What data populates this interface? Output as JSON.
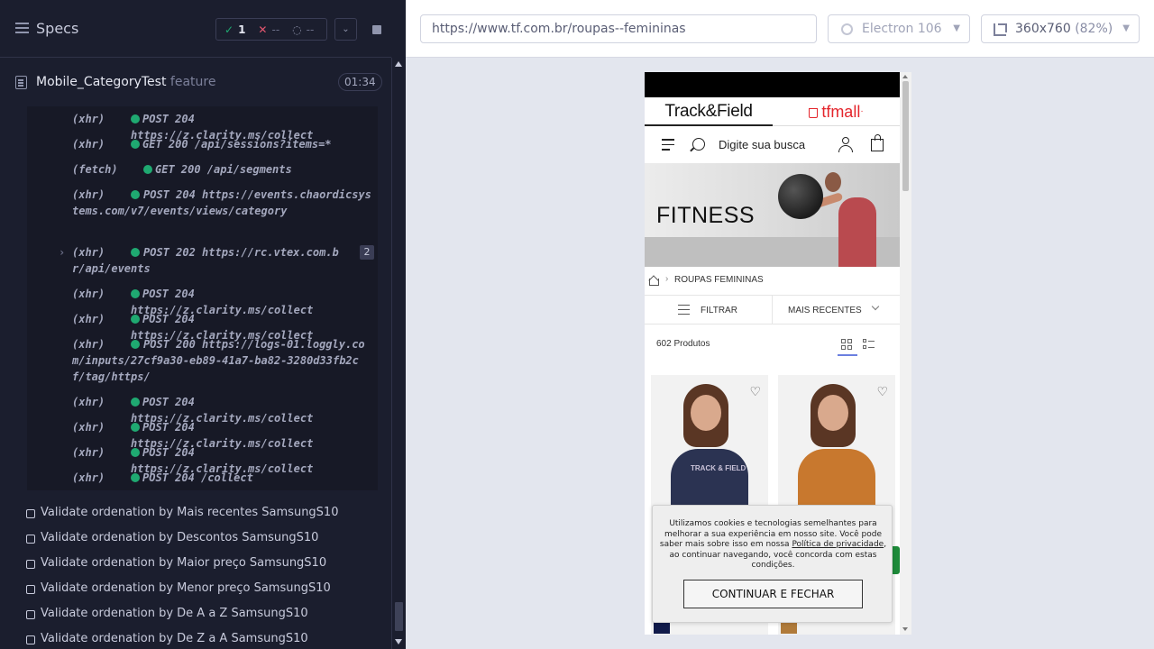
{
  "reporter": {
    "title": "Specs",
    "stats": {
      "passed": "1",
      "failed": "--",
      "pending": "--"
    },
    "spec": {
      "name": "Mobile_CategoryTest",
      "ext": "feature",
      "duration": "01:34"
    },
    "logs": [
      {
        "type": "(xhr)",
        "msg": "POST 204 https://z.clarity.ms/collect"
      },
      {
        "type": "(xhr)",
        "msg": "GET 200 /api/sessions?items=*"
      },
      {
        "type": "(fetch)",
        "msg": "GET 200 /api/segments"
      },
      {
        "type": "(xhr)",
        "msg": "POST 204 https://events.chaordicsystems.com/v7/events/views/category"
      },
      {
        "type": "(xhr)",
        "msg": "POST 202 https://rc.vtex.com.br/api/events",
        "count": "2"
      },
      {
        "type": "(xhr)",
        "msg": "POST 204 https://z.clarity.ms/collect"
      },
      {
        "type": "(xhr)",
        "msg": "POST 204 https://z.clarity.ms/collect"
      },
      {
        "type": "(xhr)",
        "msg": "POST 200 https://logs-01.loggly.com/inputs/27cf9a30-eb89-41a7-ba82-3280d33fb2cf/tag/https/"
      },
      {
        "type": "(xhr)",
        "msg": "POST 204 https://z.clarity.ms/collect"
      },
      {
        "type": "(xhr)",
        "msg": "POST 204 https://z.clarity.ms/collect"
      },
      {
        "type": "(xhr)",
        "msg": "POST 204 https://z.clarity.ms/collect"
      },
      {
        "type": "(xhr)",
        "msg": "POST 204 /collect"
      }
    ],
    "tests": [
      "Validate ordenation by Mais recentes SamsungS10",
      "Validate ordenation by Descontos SamsungS10",
      "Validate ordenation by Maior preço SamsungS10",
      "Validate ordenation by Menor preço SamsungS10",
      "Validate ordenation by De A a Z SamsungS10",
      "Validate ordenation by De Z a A SamsungS10"
    ]
  },
  "browser_bar": {
    "url": "https://www.tf.com.br/roupas--femininas",
    "browser": "Electron 106",
    "viewport": "360x760",
    "scale": "(82%)"
  },
  "site": {
    "brand_tf": "Track&Field",
    "brand_mall": "tfmall",
    "search_placeholder": "Digite sua busca",
    "hero_title": "FITNESS",
    "breadcrumb": "ROUPAS FEMININAS",
    "filter_label": "FILTRAR",
    "sort_label": "MAIS RECENTES",
    "product_count": "602 Produtos",
    "tee_print": "TRACK & FIELD",
    "cookie": {
      "text_before": "Utilizamos cookies e tecnologias semelhantes para melhorar a sua experiência em nosso site. Você pode saber mais sobre isso em nossa ",
      "link": "Política de privacidade",
      "text_after": ", ao continuar navegando, você concorda com estas condições.",
      "button": "CONTINUAR E FECHAR"
    },
    "colors": {
      "brand_red": "#e4252c",
      "tee_navy": "#2b3352",
      "jacket_orange": "#c8782e",
      "swatch_navy": "#101a4a",
      "swatch_orange": "#b07a3a"
    }
  }
}
